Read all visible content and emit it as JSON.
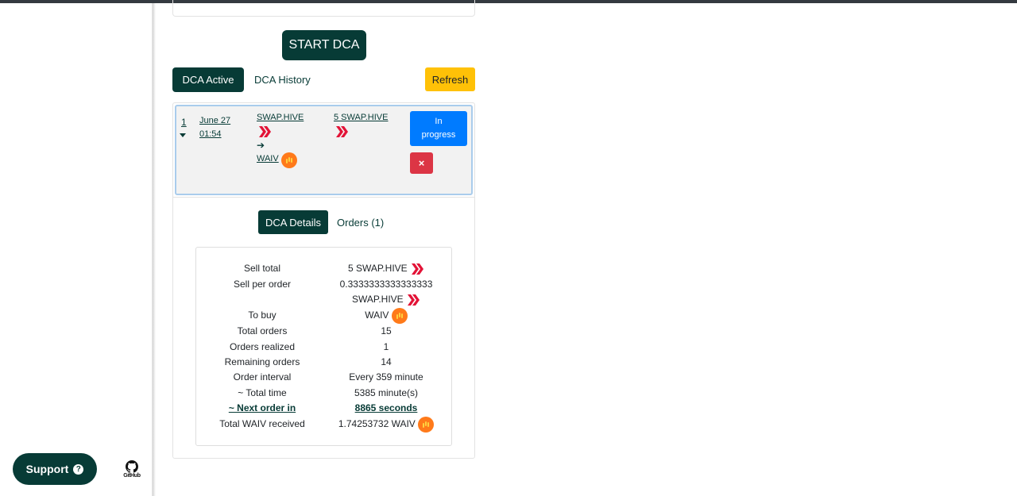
{
  "sidebar": {
    "support_label": "Support",
    "github_label": "GitHub"
  },
  "main": {
    "start_button": "START DCA",
    "tabs": [
      {
        "label": "DCA Active",
        "active": true
      },
      {
        "label": "DCA History",
        "active": false
      }
    ],
    "refresh_button": "Refresh"
  },
  "active_dca": {
    "index": "1",
    "date": "June 27",
    "time": "01:54",
    "from_token": "SWAP.HIVE",
    "arrow": "➔",
    "to_token": "WAIV",
    "amount": "5 SWAP.HIVE",
    "status_line1": "In",
    "status_line2": "progress",
    "cancel_icon": "×"
  },
  "details_tabs": [
    {
      "label": "DCA Details",
      "active": true
    },
    {
      "label": "Orders (1)",
      "active": false
    }
  ],
  "details": {
    "sell_total_label": "Sell total",
    "sell_total_value": "5 SWAP.HIVE",
    "sell_per_order_label": "Sell per order",
    "sell_per_order_value": "0.3333333333333333",
    "sell_per_order_unit": "SWAP.HIVE",
    "to_buy_label": "To buy",
    "to_buy_value": "WAIV",
    "total_orders_label": "Total orders",
    "total_orders_value": "15",
    "orders_realized_label": "Orders realized",
    "orders_realized_value": "1",
    "remaining_orders_label": "Remaining orders",
    "remaining_orders_value": "14",
    "order_interval_label": "Order interval",
    "order_interval_value": "Every 359 minute",
    "total_time_label": "~ Total time",
    "total_time_value": "5385 minute(s)",
    "next_order_label": "~ Next order in",
    "next_order_value": "8865 seconds",
    "total_received_label": "Total WAIV received",
    "total_received_value": "1.74253732 WAIV"
  },
  "colors": {
    "brand": "#073b36",
    "refresh": "#ffc107",
    "status": "#007bff",
    "cancel": "#dc3545",
    "hive": "#e31337",
    "waiv": "#ff7a1a"
  },
  "icons": [
    "question-circle-icon",
    "github-icon",
    "chevron-down-icon",
    "arrow-right-icon",
    "hive-icon",
    "waiv-icon",
    "close-icon"
  ]
}
